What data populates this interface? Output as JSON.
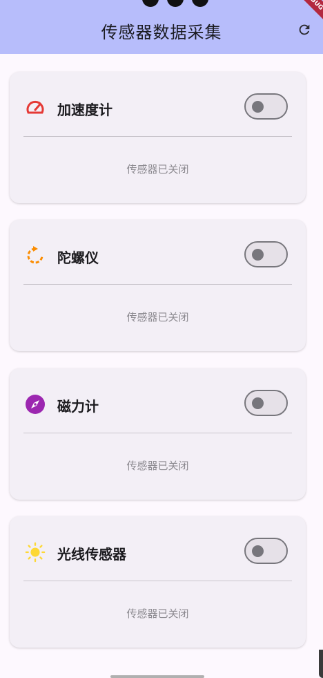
{
  "appbar": {
    "title": "传感器数据采集",
    "refresh_icon": "refresh-icon",
    "debug_label": "DEBUG"
  },
  "sensors": [
    {
      "name": "加速度计",
      "icon": "speedometer-icon",
      "icon_color": "#e53935",
      "enabled": false,
      "status": "传感器已关闭"
    },
    {
      "name": "陀螺仪",
      "icon": "rotate-icon",
      "icon_color": "#fb8c00",
      "enabled": false,
      "status": "传感器已关闭"
    },
    {
      "name": "磁力计",
      "icon": "compass-icon",
      "icon_color": "#9c27b0",
      "enabled": false,
      "status": "传感器已关闭"
    },
    {
      "name": "光线传感器",
      "icon": "sun-icon",
      "icon_color": "#fdd835",
      "enabled": false,
      "status": "传感器已关闭"
    }
  ],
  "colors": {
    "appbar_bg": "#b7bdfb",
    "card_bg": "#f3eff6",
    "toggle_off": "#77767c"
  }
}
